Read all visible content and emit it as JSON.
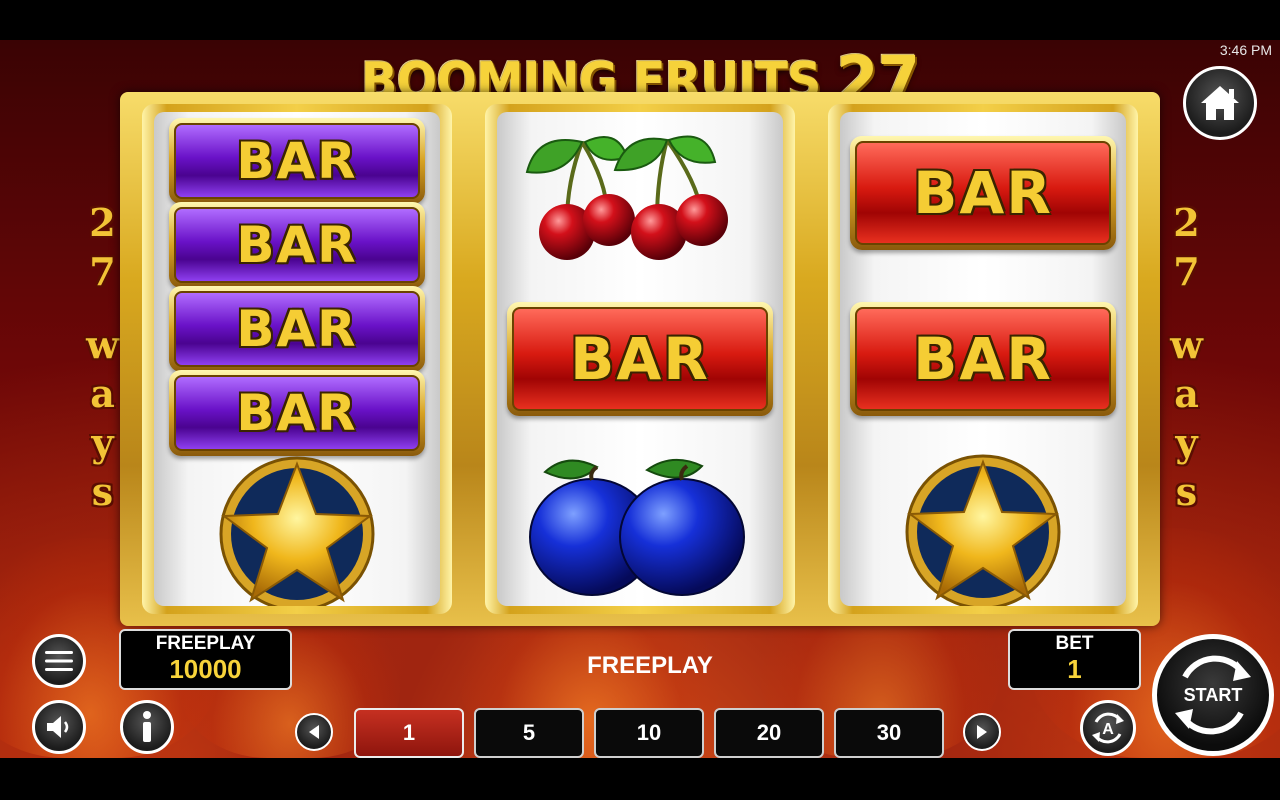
{
  "status_bar": {
    "time": "3:46 PM"
  },
  "game": {
    "title_text": "BOOMING FRUITS",
    "title_number": "27",
    "side_label_number": "27",
    "side_label_word": "ways"
  },
  "reels": [
    {
      "symbols": [
        "BAR",
        "BAR",
        "BAR",
        "BAR",
        "star-icon"
      ]
    },
    {
      "symbols": [
        "cherries-icon",
        "BAR",
        "plums-icon"
      ]
    },
    {
      "symbols": [
        "BAR",
        "BAR",
        "star-icon"
      ]
    }
  ],
  "balance": {
    "label": "FREEPLAY",
    "value": "10000"
  },
  "message": "FREEPLAY",
  "bet": {
    "label": "BET",
    "value": "1"
  },
  "bet_options": [
    "1",
    "5",
    "10",
    "20",
    "30"
  ],
  "selected_bet": "1",
  "buttons": {
    "start_label": "START"
  },
  "icons": [
    "home-icon",
    "menu-icon",
    "sound-icon",
    "info-icon",
    "arrow-left-icon",
    "arrow-right-icon",
    "autoplay-icon",
    "start-icon"
  ],
  "colors": {
    "gold": "#f2c436",
    "bet_active": "#b52618",
    "background": "#6d0707"
  }
}
